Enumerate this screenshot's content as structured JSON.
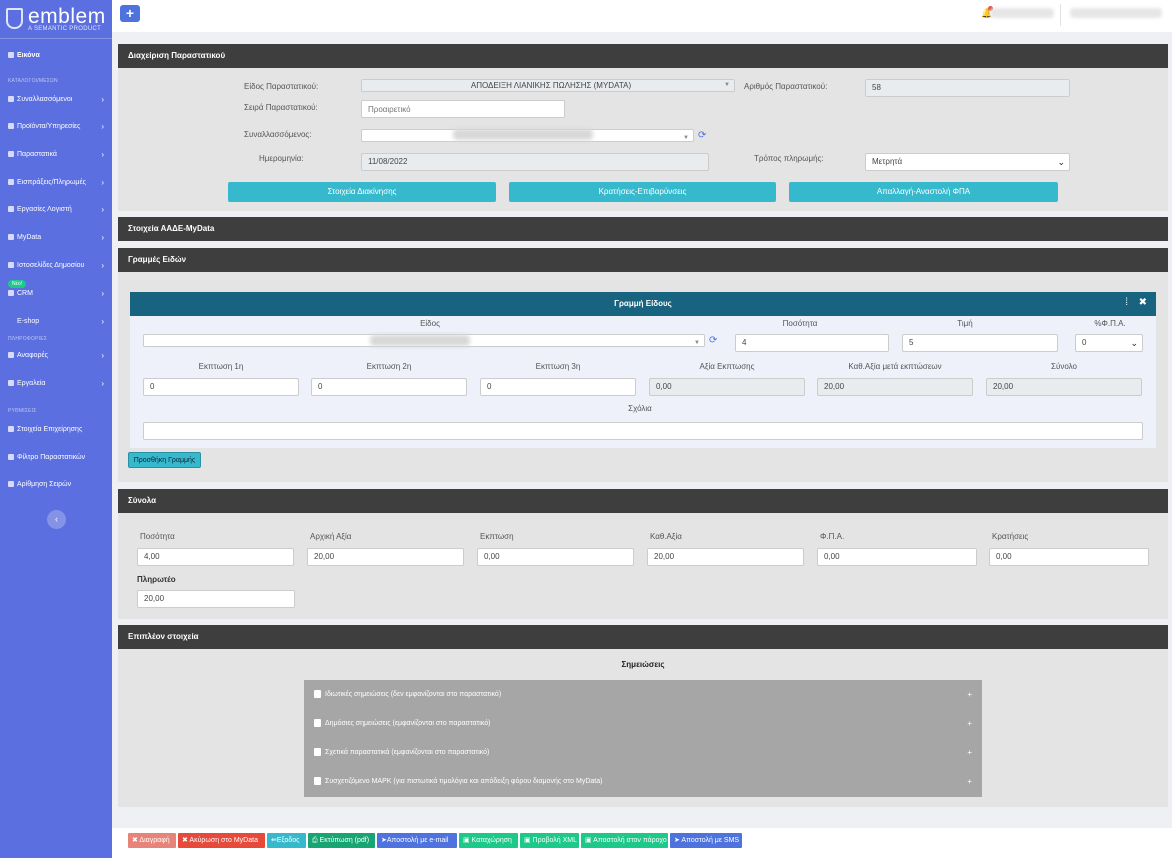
{
  "brand": {
    "name": "emblem",
    "tagline": "A SEMANTIC PRODUCT"
  },
  "sidebar": {
    "dashboard": "Εικόνα",
    "heading_catalogs": "ΚΑΤΑΛΟΓΟΙ/ΜΕΣΩΝ",
    "items_a": [
      {
        "label": "Συναλλασσόμενοι",
        "icon": "users-icon"
      },
      {
        "label": "Προϊόντα/Υπηρεσίες",
        "icon": "box-icon"
      },
      {
        "label": "Παραστατικά",
        "icon": "document-icon"
      },
      {
        "label": "Εισπράξεις/Πληρωμές",
        "icon": "money-icon"
      },
      {
        "label": "Εργασίες Λογιστή",
        "icon": "briefcase-icon"
      },
      {
        "label": "MyData",
        "icon": "database-icon"
      },
      {
        "label": "Ιστοσελίδες Δημοσίου",
        "icon": "globe-icon"
      }
    ],
    "crm_badge": "Νέο!",
    "crm": "CRM",
    "eshop": "E-shop",
    "heading_reports": "ΠΛΗΡΟΦΟΡΙΕΣ",
    "reports": "Αναφορές",
    "tools": "Εργαλεία",
    "heading_settings": "ΡΥΘΜΙΣΕΙΣ",
    "items_c": [
      {
        "label": "Στοιχεία Επιχείρησης",
        "icon": "gear-icon"
      },
      {
        "label": "Φίλτρο Παραστατικών",
        "icon": "filter-icon"
      },
      {
        "label": "Αρίθμηση Σειρών",
        "icon": "filter-icon"
      }
    ],
    "collapse": "‹"
  },
  "topbar": {
    "add": "+"
  },
  "doc": {
    "title": "Διαχείριση Παραστατικού",
    "type_label": "Είδος Παραστατικού:",
    "type_value": "ΑΠΟΔΕΙΞΗ ΛΙΑΝΙΚΗΣ ΠΩΛΗΣΗΣ (MYDATA)",
    "number_label": "Αριθμός Παραστατικού:",
    "number_value": "58",
    "series_label": "Σειρά Παραστατικού:",
    "series_placeholder": "Προαιρετικό",
    "party_label": "Συναλλασσόμενος:",
    "date_label": "Ημερομηνία:",
    "date_value": "11/08/2022",
    "payment_label": "Τρόπος πληρωμής:",
    "payment_value": "Μετρητά",
    "btn_delivery": "Στοιχεία Διακίνησης",
    "btn_withholdings": "Κρατήσεις-Επιβαρύνσεις",
    "btn_vat": "Απαλλαγή-Αναστολή ΦΠΑ"
  },
  "aade": {
    "title": "Στοιχεία ΑΑΔΕ-MyData"
  },
  "lines": {
    "title": "Γραμμές Ειδών",
    "box_title": "Γραμμή Είδους",
    "item_label": "Είδος",
    "qty_label": "Ποσότητα",
    "qty_value": "4",
    "price_label": "Τιμή",
    "price_value": "5",
    "vat_label": "%Φ.Π.Α.",
    "vat_value": "0",
    "d1_label": "Εκπτωση 1η",
    "d1_value": "0",
    "d2_label": "Εκπτωση 2η",
    "d2_value": "0",
    "d3_label": "Εκπτωση 3η",
    "d3_value": "0",
    "dval_label": "Αξία Εκπτωσης",
    "dval_value": "0,00",
    "net_label": "Καθ.Αξία μετά εκπτώσεων",
    "net_value": "20,00",
    "total_label": "Σύνολο",
    "total_value": "20,00",
    "comments_label": "Σχόλια",
    "add_line": "Προσθήκη Γραμμής"
  },
  "totals": {
    "title": "Σύνολα",
    "qty_label": "Ποσότητα",
    "qty": "4,00",
    "initial_label": "Αρχική Αξία",
    "initial": "20,00",
    "discount_label": "Εκπτωση",
    "discount": "0,00",
    "net_label": "Καθ.Αξία",
    "net": "20,00",
    "vat_label": "Φ.Π.Α.",
    "vat": "0,00",
    "withholdings_label": "Κρατήσεις",
    "withholdings": "0,00",
    "payable_label": "Πληρωτέο",
    "payable": "20,00"
  },
  "extra": {
    "title": "Επιπλέον στοιχεία",
    "notes_title": "Σημειώσεις",
    "notes": [
      {
        "label": "Ιδιωτικές σημειώσεις (δεν εμφανίζονται στο παραστατικό)",
        "icon": "clipboard-icon"
      },
      {
        "label": "Δημόσιες σημειώσεις (εμφανίζονται στο παραστατικό)",
        "icon": "users-icon"
      },
      {
        "label": "Σχετικά παραστατικά (εμφανίζονται στο παραστατικό)",
        "icon": "copy-icon"
      },
      {
        "label": "Συσχετιζόμενο MAPK (για πιστωτικά τιμολόγια και απόδειξη φόρου διαμονής στο MyData)",
        "icon": "copy-icon"
      }
    ],
    "plus": "+"
  },
  "footer": {
    "buttons": [
      {
        "label": "✖ Διαγραφή",
        "color": "#e8837a"
      },
      {
        "label": "✖ Ακύρωση στο MyData",
        "color": "#e74a3b"
      },
      {
        "label": "⇚Εξοδος",
        "color": "#36b9cc"
      },
      {
        "label": "⎙ Εκτύπωση (pdf)",
        "color": "#17a673"
      },
      {
        "label": "➤Αποστολή με e-mail",
        "color": "#4e73df"
      },
      {
        "label": "▣ Καταχώρηση",
        "color": "#1cc88a"
      },
      {
        "label": "▣ Προβολή XML",
        "color": "#1cc88a"
      },
      {
        "label": "▣ Αποστολή στον πάροχο",
        "color": "#1cc88a"
      },
      {
        "label": "➤ Αποστολή με SMS",
        "color": "#4e73df"
      }
    ]
  },
  "colors": {
    "sidebar": "#5b6fe0",
    "panel_header": "#3e3e3e",
    "line_header": "#176380",
    "teal": "#36b9cc",
    "note_bg": "#a6a6a6"
  }
}
